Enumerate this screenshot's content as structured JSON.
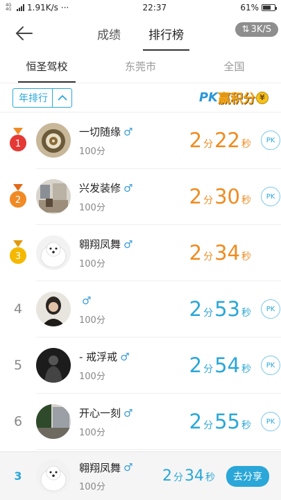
{
  "status": {
    "net": "4G 4G",
    "speed": "1.91K/s",
    "dots": "···",
    "time": "22:37",
    "battery": "61%"
  },
  "nav": {
    "tabs": [
      "成绩",
      "排行榜"
    ],
    "active": 1,
    "speed_pill": "3K/S"
  },
  "scope_tabs": [
    "恒圣驾校",
    "东莞市",
    "全国"
  ],
  "filter": {
    "label": "年排行"
  },
  "pk_banner": {
    "pk": "PK",
    "text": "赢积分",
    "coin": "¥"
  },
  "units": {
    "minute": "分",
    "second": "秒",
    "pk": "PK"
  },
  "colors": {
    "accent": "#2aa7d8",
    "orange": "#ef8b1f",
    "gold": "#f5b800"
  },
  "rows": [
    {
      "rank": "1",
      "name": "一切随缘",
      "gender": "♂",
      "points": "100分",
      "min": "2",
      "sec": "22",
      "pk": true
    },
    {
      "rank": "2",
      "name": "兴发装修",
      "gender": "♂",
      "points": "100分",
      "min": "2",
      "sec": "30",
      "pk": true
    },
    {
      "rank": "3",
      "name": "翱翔凤舞",
      "gender": "♂",
      "points": "100分",
      "min": "2",
      "sec": "34",
      "pk": false
    },
    {
      "rank": "4",
      "name": "",
      "gender": "♂",
      "points": "100分",
      "min": "2",
      "sec": "53",
      "pk": true
    },
    {
      "rank": "5",
      "name": "- 戒浮戒",
      "gender": "♂",
      "points": "100分",
      "min": "2",
      "sec": "54",
      "pk": true
    },
    {
      "rank": "6",
      "name": "开心一刻",
      "gender": "♂",
      "points": "100分",
      "min": "2",
      "sec": "55",
      "pk": true
    }
  ],
  "me": {
    "rank": "3",
    "name": "翱翔凤舞",
    "gender": "♂",
    "points": "100分",
    "min": "2",
    "sec": "34",
    "share_label": "去分享"
  }
}
